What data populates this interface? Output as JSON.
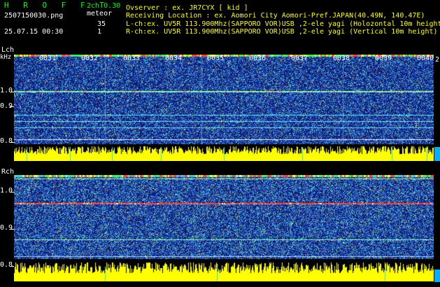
{
  "header": {
    "app_title": "H R O F F T",
    "mode": "2ch 0.30",
    "detect_label": "meteor",
    "filename": "2507150030.png",
    "datetime": "25.07.15 00:30",
    "count_l": "35",
    "count_r": "1",
    "observer": "Ovserver            : ex. JR7CYX [ kid ]",
    "location": "Receiving Location : ex. Aomori City Aomori-Pref.JAPAN(40.49N, 140.47E)",
    "lch_info": "L-ch:ex. UV5R 113.900Mhz(SAPPORO VOR)USB ,2-ele yagi (Holozontal 10m height)",
    "rch_info": "R-ch:ex. UV5R 113.900Mhz(SAPPORO VOR)USB ,2-ele yagi (Vertical 10m height)"
  },
  "lch": {
    "label": "Lch",
    "unit": "kHz",
    "yticks": [
      "1.0",
      "0.9",
      "0.8"
    ],
    "time_labels": [
      "0031",
      "0032",
      "0033",
      "0034",
      "0035",
      "0036",
      "0037",
      "0038",
      "0039",
      "0040"
    ],
    "right_marker": "2"
  },
  "rch": {
    "label": "Rch",
    "yticks": [
      "1.0",
      "0.9",
      "0.8"
    ]
  },
  "colors": {
    "background": "#000000",
    "noise": "#1a2d9a",
    "signal": "#ffff00",
    "carrier": "#ff3030",
    "title": "#00ff00"
  }
}
